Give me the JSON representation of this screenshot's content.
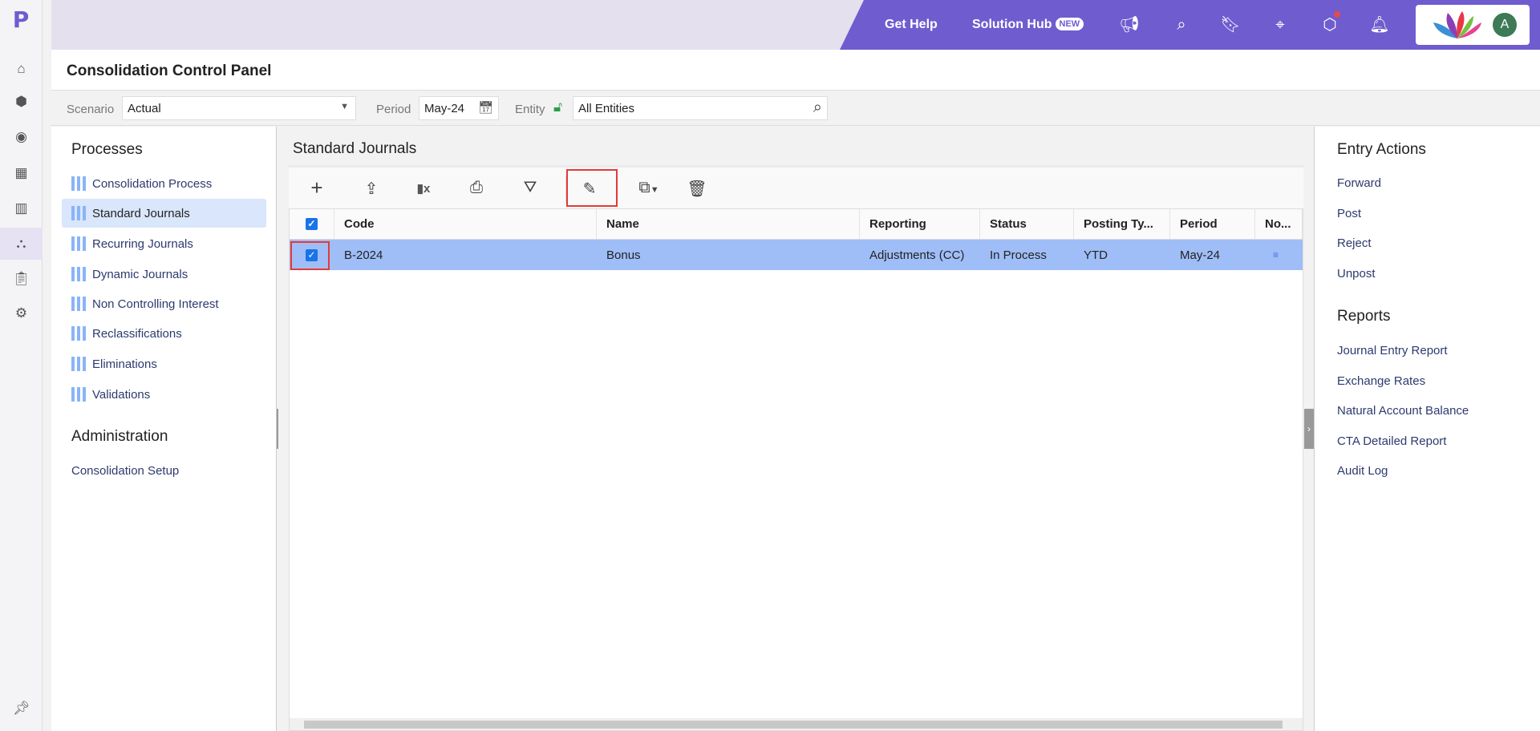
{
  "app": {
    "logo": "P",
    "title": "Consolidation Control Panel"
  },
  "rail": {
    "icons": [
      "home-icon",
      "cube-icon",
      "target-icon",
      "grid-icon",
      "report-icon",
      "hierarchy-icon",
      "clipboard-icon",
      "gear-icon",
      "pin-icon"
    ],
    "selected": "hierarchy-icon"
  },
  "topbar": {
    "get_help": "Get Help",
    "solution_hub": "Solution Hub",
    "new_badge": "NEW",
    "avatar": "A",
    "accent": "#6f5ccf"
  },
  "filters": {
    "scenario_label": "Scenario",
    "scenario_value": "Actual",
    "period_label": "Period",
    "period_value": "May-24",
    "entity_label": "Entity",
    "entity_value": "All Entities"
  },
  "left": {
    "processes_title": "Processes",
    "processes": [
      "Consolidation Process",
      "Standard Journals",
      "Recurring Journals",
      "Dynamic Journals",
      "Non Controlling Interest",
      "Reclassifications",
      "Eliminations",
      "Validations"
    ],
    "selected": "Standard Journals",
    "admin_title": "Administration",
    "admin_items": [
      "Consolidation Setup"
    ]
  },
  "center": {
    "title": "Standard Journals",
    "toolbar": [
      "add-icon",
      "upload-icon",
      "excel-icon",
      "print-icon",
      "filter-icon",
      "edit-icon",
      "copy-icon",
      "delete-icon"
    ],
    "columns": [
      "Code",
      "Name",
      "Reporting",
      "Status",
      "Posting Ty...",
      "Period",
      "No..."
    ],
    "rows": [
      {
        "code": "B-2024",
        "name": "Bonus",
        "reporting": "Adjustments (CC)",
        "status": "In Process",
        "posting": "YTD",
        "period": "May-24",
        "checked": true
      }
    ]
  },
  "right": {
    "entry_title": "Entry Actions",
    "entry_actions": [
      "Forward",
      "Post",
      "Reject",
      "Unpost"
    ],
    "reports_title": "Reports",
    "reports": [
      "Journal Entry Report",
      "Exchange Rates",
      "Natural Account Balance",
      "CTA Detailed Report",
      "Audit Log"
    ]
  }
}
